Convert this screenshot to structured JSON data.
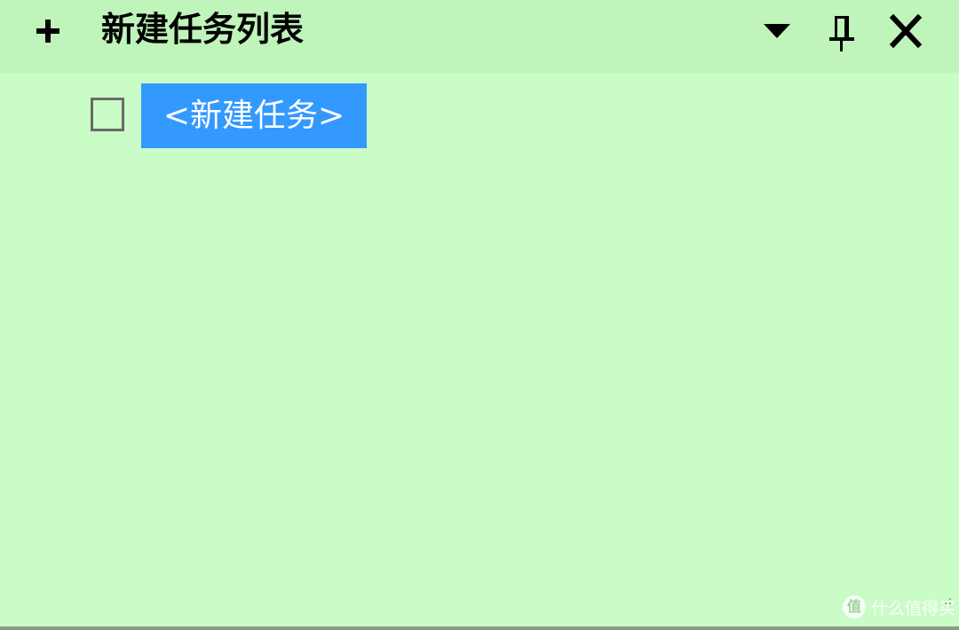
{
  "window": {
    "title": "新建任务列表",
    "controls": {
      "add": "plus-icon",
      "menu": "dropdown-triangle-icon",
      "pin": "pin-icon",
      "close": "close-icon"
    }
  },
  "tasks": [
    {
      "checked": false,
      "text": "<新建任务>",
      "selected": true
    }
  ],
  "watermark": {
    "logo": "值",
    "text": "什么值得买"
  },
  "colors": {
    "background": "#c9fcc6",
    "titlebar": "#bff4bb",
    "selection": "#3399ff",
    "selection_text": "#ffffff",
    "checkbox_border": "#6a6a6a"
  }
}
